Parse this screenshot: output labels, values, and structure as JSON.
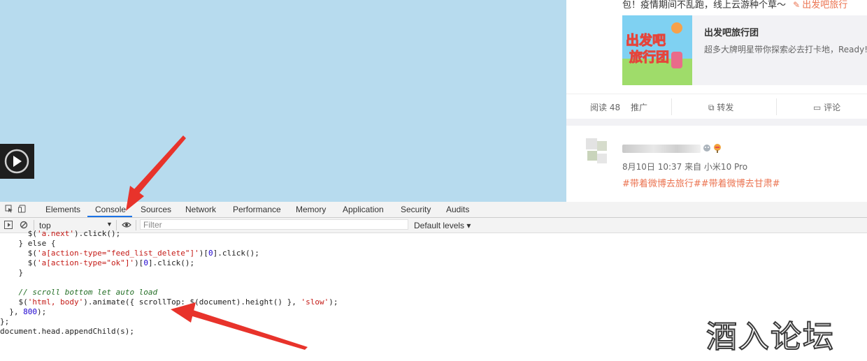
{
  "feed": {
    "post1": {
      "text_line": "包！疫情期间不乱跑，线上云游种个草～",
      "source_label": "出发吧旅行",
      "link_card": {
        "title": "出发吧旅行团",
        "description": "超多大牌明星带你探索必去打卡地，Ready!",
        "thumb_text_top": "出发吧",
        "thumb_text_bottom": "旅行团"
      },
      "actions": {
        "reads": "阅读 48",
        "promote": "推广",
        "repost": "转发",
        "comment": "评论"
      }
    },
    "post2": {
      "badges": "☺",
      "meta": "8月10日 10:37 来自 小米10 Pro",
      "tags": "#带着微博去旅行##带着微博去甘肃#"
    }
  },
  "devtools": {
    "tabs": [
      "Elements",
      "Console",
      "Sources",
      "Network",
      "Performance",
      "Memory",
      "Application",
      "Security",
      "Audits"
    ],
    "active_tab": "Console",
    "context": "top",
    "filter_placeholder": "Filter",
    "levels": "Default levels ▾"
  },
  "console_lines": [
    "      $('a.next').click();",
    "    } else {",
    "      $('a[action-type=\"feed_list_delete\"]')[0].click();",
    "      $('a[action-type=\"ok\"]')[0].click();",
    "    }",
    "",
    "    // scroll bottom let auto load",
    "    $('html, body').animate({ scrollTop: $(document).height() }, 'slow');",
    "  }, 800);",
    "};",
    "document.head.appendChild(s);"
  ],
  "watermark": "酒入论坛",
  "colors": {
    "page_bg": "#b7dbee",
    "accent_orange": "#eb7350",
    "devtools_active": "#1a73e8",
    "arrow_red": "#e8332b"
  }
}
